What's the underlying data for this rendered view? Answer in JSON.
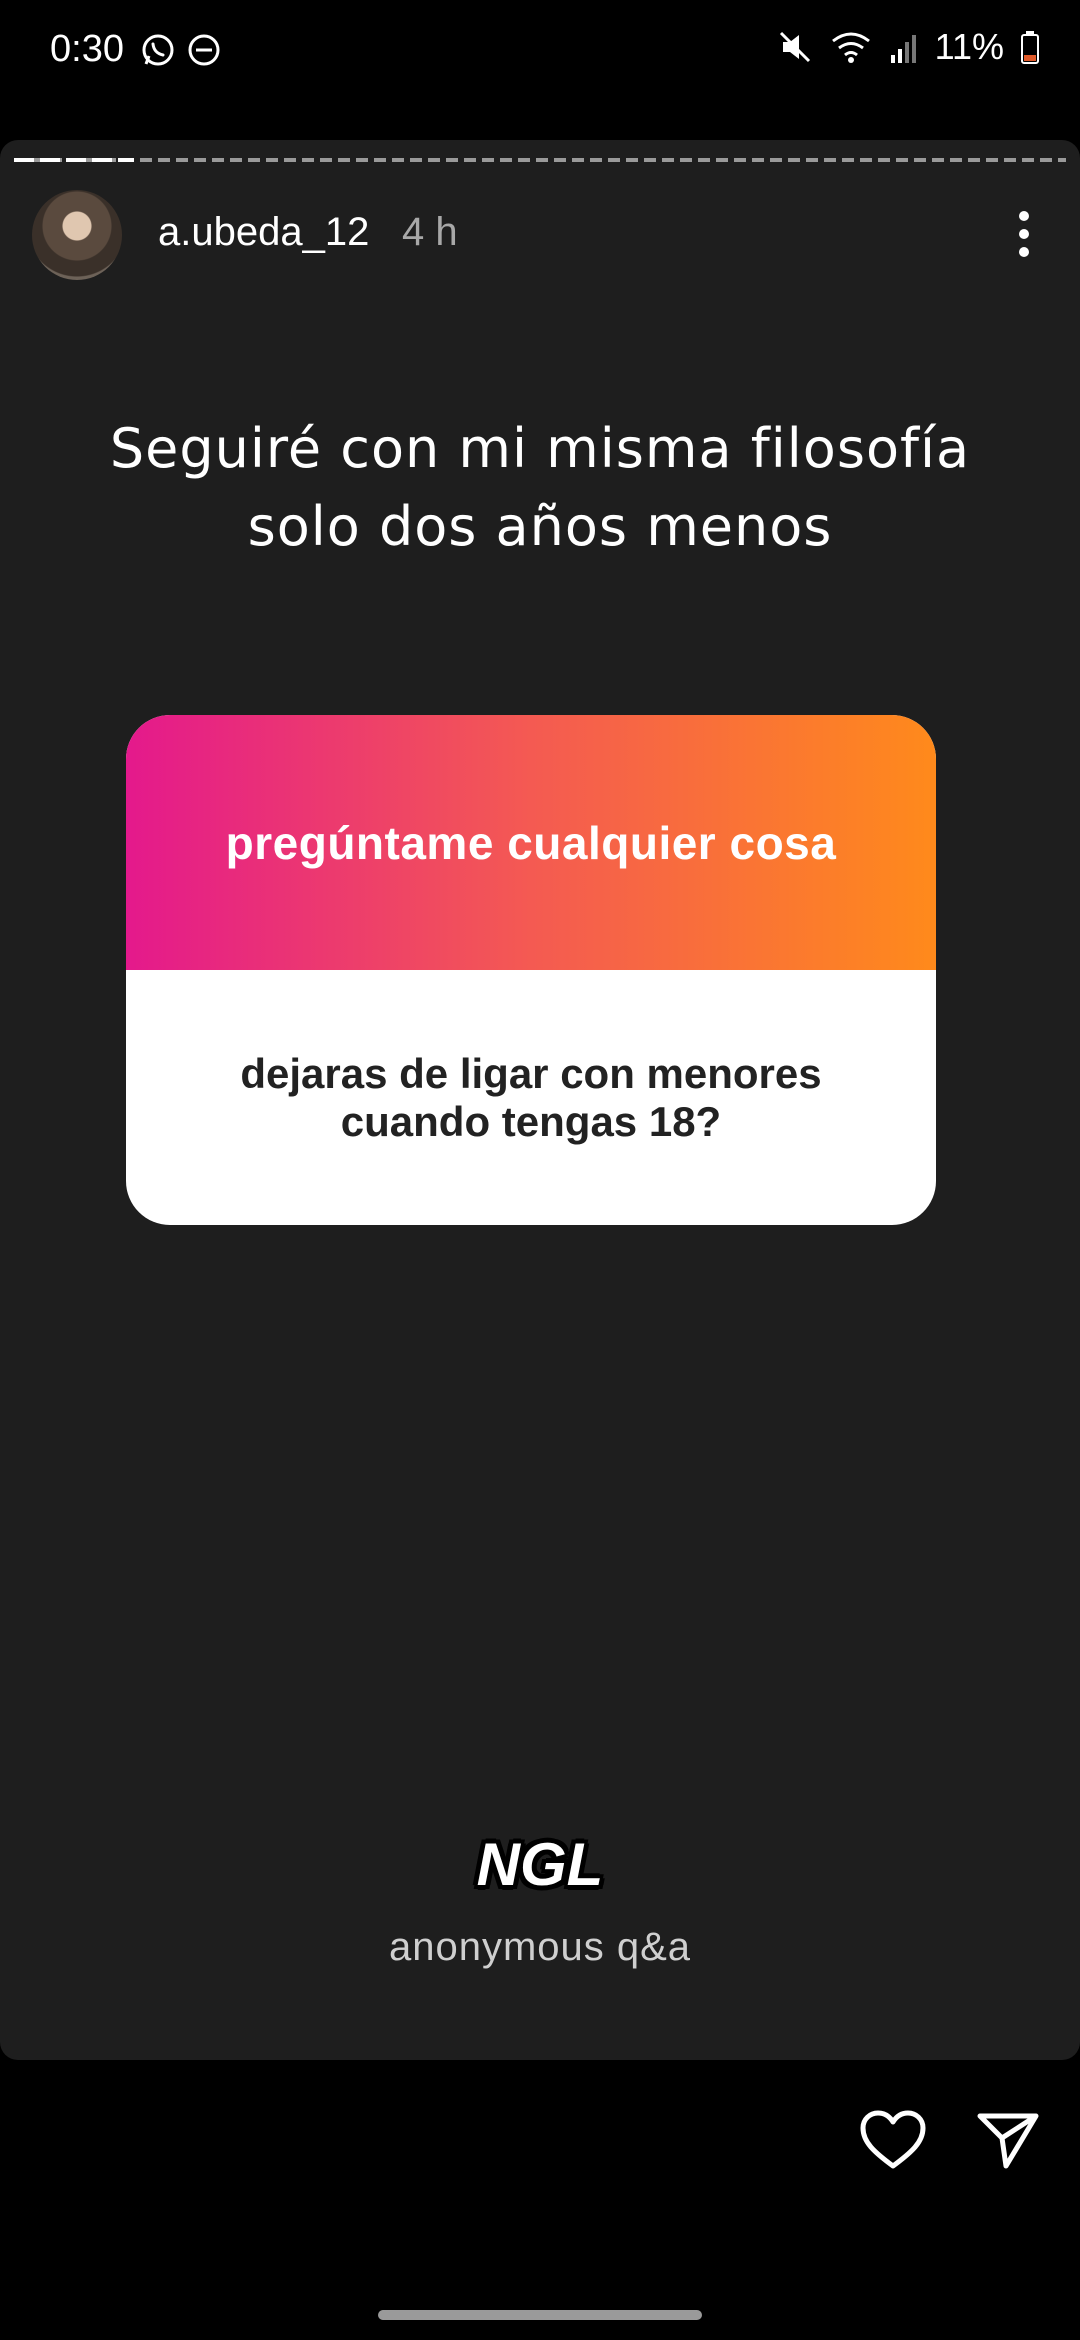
{
  "status_bar": {
    "time": "0:30",
    "battery": "11%",
    "left_icons": [
      "whatsapp-icon",
      "do-not-disturb-icon"
    ],
    "right_icons": [
      "mute-icon",
      "wifi-icon",
      "signal-icon",
      "battery-icon"
    ],
    "battery_color": "#e05a2a"
  },
  "story": {
    "username": "a.ubeda_12",
    "time_ago": "4 h",
    "caption_line1": "Seguiré con mi misma filosofía",
    "caption_line2": "solo dos años menos",
    "question_card": {
      "prompt": "pregúntame cualquier cosa",
      "question": "dejaras de ligar con menores\ncuando tengas 18?",
      "gradient": [
        "#e4198c",
        "#ff8a1b"
      ]
    },
    "sticker_logo": "NGL",
    "sticker_subtitle": "anonymous q&a"
  },
  "actions": {
    "like_icon": "heart-icon",
    "share_icon": "send-icon"
  }
}
